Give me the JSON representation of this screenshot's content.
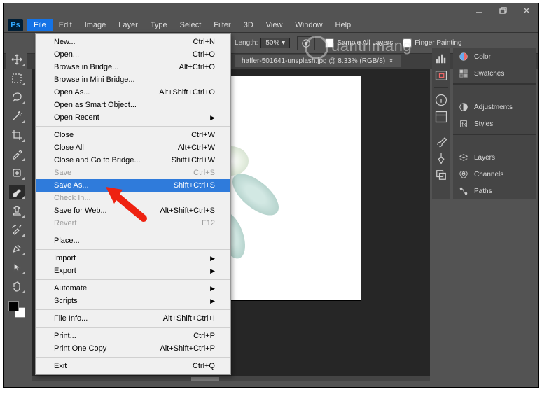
{
  "window": {
    "ps_badge": "Ps"
  },
  "menubar": [
    "File",
    "Edit",
    "Image",
    "Layer",
    "Type",
    "Select",
    "Filter",
    "3D",
    "View",
    "Window",
    "Help"
  ],
  "menubar_active_index": 0,
  "optbar": {
    "length_label": "Length:",
    "length_value": "50%",
    "sample_all": "Sample All Layers",
    "finger": "Finger Painting"
  },
  "doc_tab": "haffer-501641-unsplash.jpg @ 8.33% (RGB/8)",
  "file_menu": {
    "groups": [
      [
        {
          "label": "New...",
          "shortcut": "Ctrl+N",
          "enabled": true
        },
        {
          "label": "Open...",
          "shortcut": "Ctrl+O",
          "enabled": true
        },
        {
          "label": "Browse in Bridge...",
          "shortcut": "Alt+Ctrl+O",
          "enabled": true
        },
        {
          "label": "Browse in Mini Bridge...",
          "shortcut": "",
          "enabled": true
        },
        {
          "label": "Open As...",
          "shortcut": "Alt+Shift+Ctrl+O",
          "enabled": true
        },
        {
          "label": "Open as Smart Object...",
          "shortcut": "",
          "enabled": true
        },
        {
          "label": "Open Recent",
          "shortcut": "",
          "enabled": true,
          "submenu": true
        }
      ],
      [
        {
          "label": "Close",
          "shortcut": "Ctrl+W",
          "enabled": true
        },
        {
          "label": "Close All",
          "shortcut": "Alt+Ctrl+W",
          "enabled": true
        },
        {
          "label": "Close and Go to Bridge...",
          "shortcut": "Shift+Ctrl+W",
          "enabled": true
        },
        {
          "label": "Save",
          "shortcut": "Ctrl+S",
          "enabled": false
        },
        {
          "label": "Save As...",
          "shortcut": "Shift+Ctrl+S",
          "enabled": true,
          "highlight": true
        },
        {
          "label": "Check In...",
          "shortcut": "",
          "enabled": false
        },
        {
          "label": "Save for Web...",
          "shortcut": "Alt+Shift+Ctrl+S",
          "enabled": true
        },
        {
          "label": "Revert",
          "shortcut": "F12",
          "enabled": false
        }
      ],
      [
        {
          "label": "Place...",
          "shortcut": "",
          "enabled": true
        }
      ],
      [
        {
          "label": "Import",
          "shortcut": "",
          "enabled": true,
          "submenu": true
        },
        {
          "label": "Export",
          "shortcut": "",
          "enabled": true,
          "submenu": true
        }
      ],
      [
        {
          "label": "Automate",
          "shortcut": "",
          "enabled": true,
          "submenu": true
        },
        {
          "label": "Scripts",
          "shortcut": "",
          "enabled": true,
          "submenu": true
        }
      ],
      [
        {
          "label": "File Info...",
          "shortcut": "Alt+Shift+Ctrl+I",
          "enabled": true
        }
      ],
      [
        {
          "label": "Print...",
          "shortcut": "Ctrl+P",
          "enabled": true
        },
        {
          "label": "Print One Copy",
          "shortcut": "Alt+Shift+Ctrl+P",
          "enabled": true
        }
      ],
      [
        {
          "label": "Exit",
          "shortcut": "Ctrl+Q",
          "enabled": true
        }
      ]
    ]
  },
  "panels": {
    "group1": [
      "Color",
      "Swatches"
    ],
    "group2": [
      "Adjustments",
      "Styles"
    ],
    "group3": [
      "Layers",
      "Channels",
      "Paths"
    ]
  },
  "tools": [
    "move",
    "marquee",
    "lasso",
    "magic-wand",
    "crop",
    "eyedropper",
    "healing",
    "brush",
    "stamp",
    "history-brush",
    "eraser",
    "pen",
    "arrow",
    "hand"
  ],
  "watermark": "uantrimang"
}
